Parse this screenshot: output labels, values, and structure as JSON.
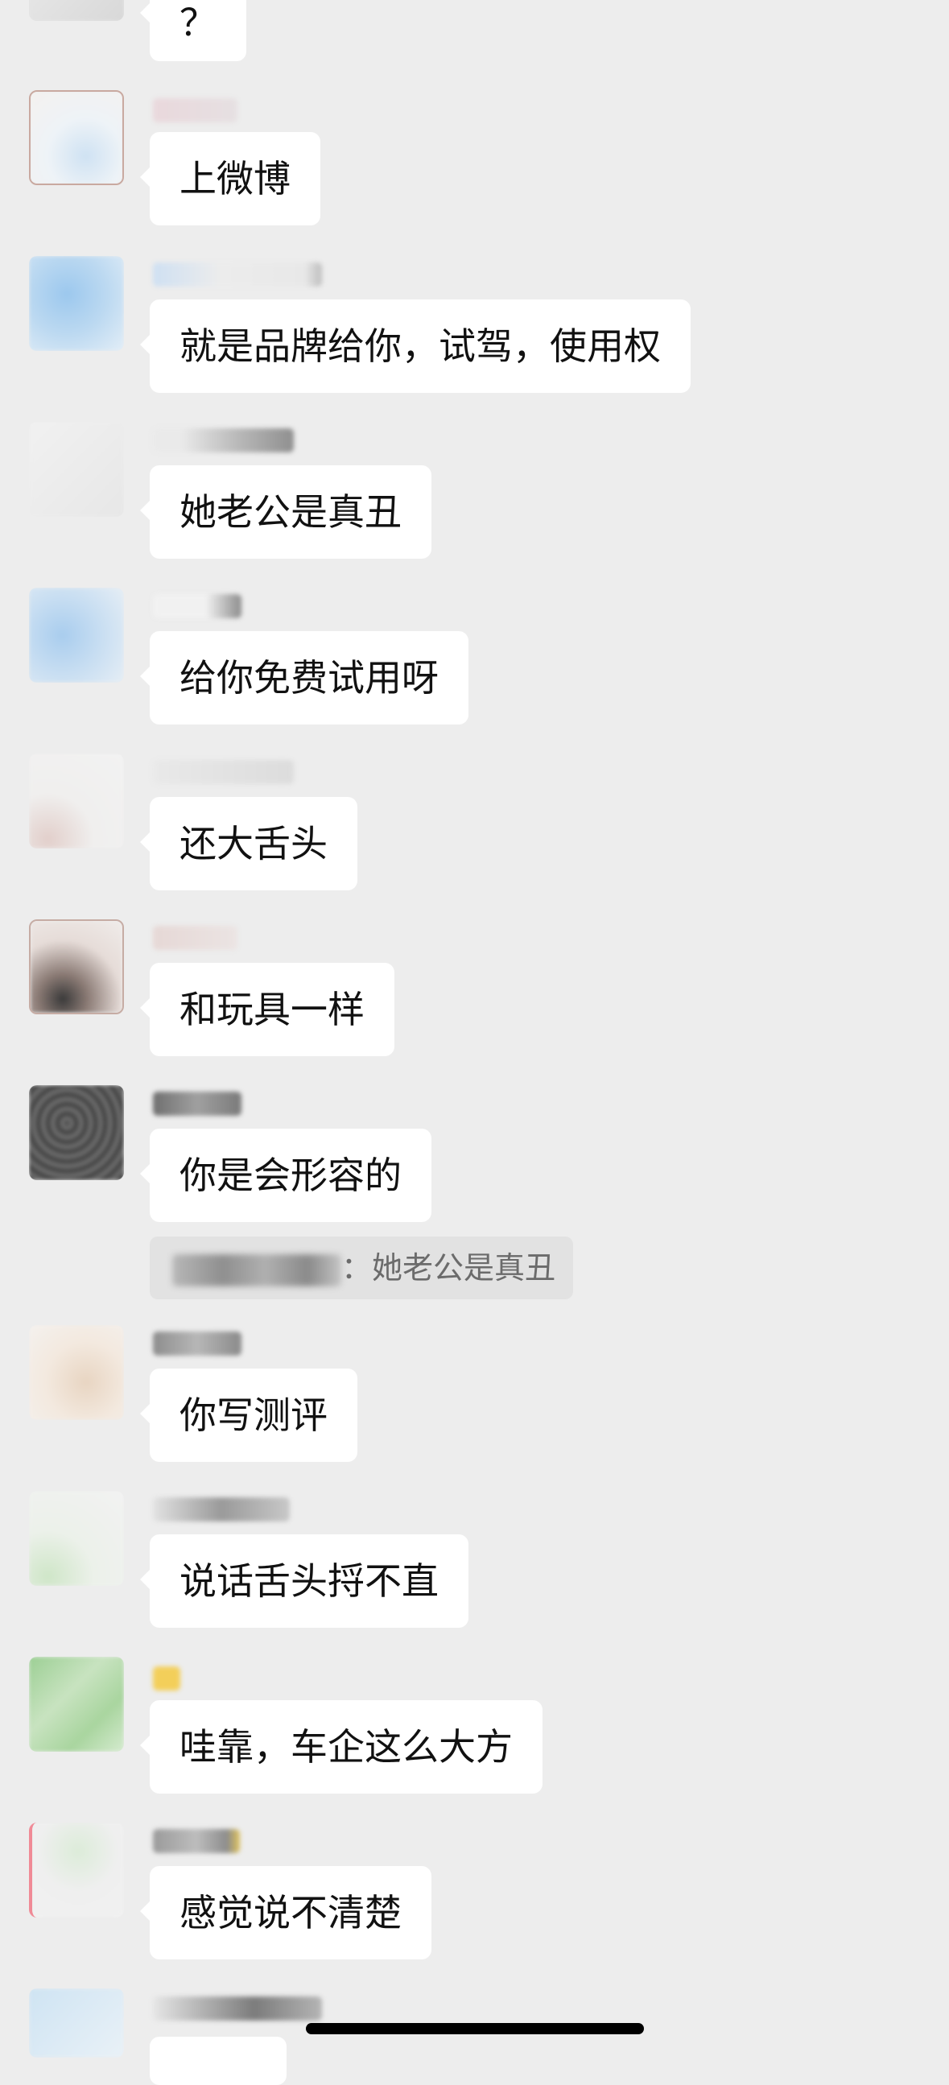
{
  "chat": {
    "top_fragment": {
      "text": "？"
    },
    "messages": [
      {
        "text": "上微博"
      },
      {
        "text": "就是品牌给你，试驾，使用权"
      },
      {
        "text": "她老公是真丑"
      },
      {
        "text": "给你免费试用呀"
      },
      {
        "text": "还大舌头"
      },
      {
        "text": "和玩具一样"
      },
      {
        "text": "你是会形容的",
        "quote": {
          "separator": "：",
          "text": "她老公是真丑"
        }
      },
      {
        "text": "你写测评"
      },
      {
        "text": "说话舌头捋不直"
      },
      {
        "text": "哇靠，车企这么大方"
      },
      {
        "text": "感觉说不清楚"
      }
    ]
  },
  "colors": {
    "background": "#ededed",
    "bubble": "#ffffff",
    "quote_background": "#e2e2e2",
    "text": "#111111",
    "quote_text": "#6b6b6b"
  }
}
